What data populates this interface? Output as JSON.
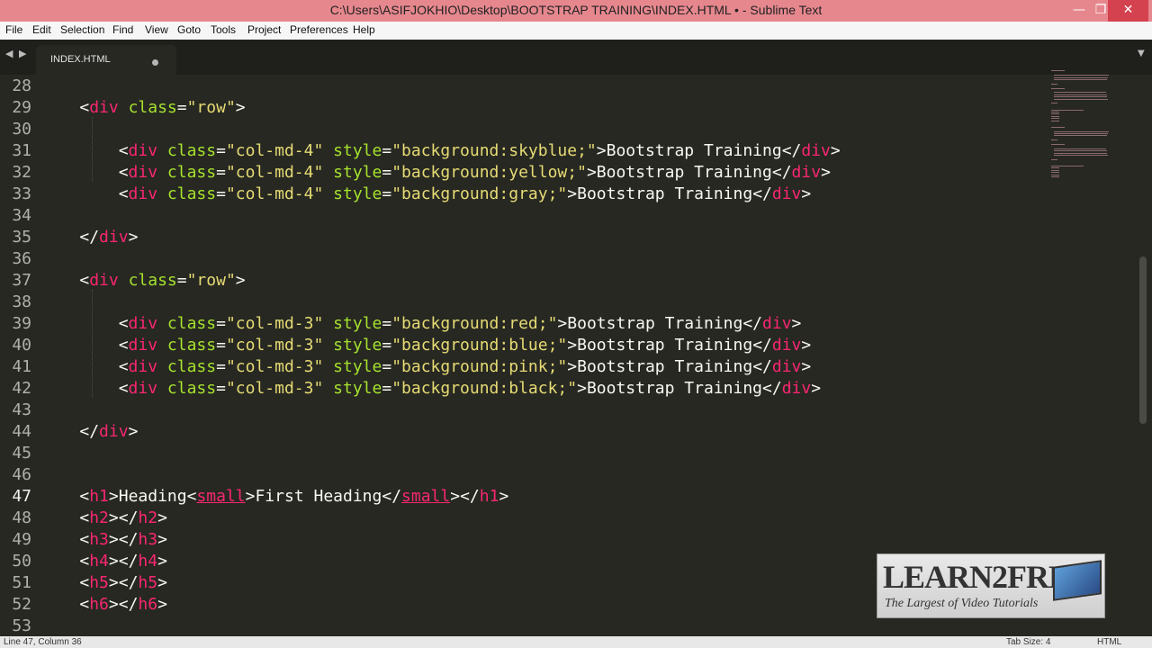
{
  "window": {
    "title": "C:\\Users\\ASIFJOKHIO\\Desktop\\BOOTSTRAP TRAINING\\INDEX.HTML • - Sublime Text",
    "minimize": "—",
    "maximize": "❐",
    "close": "✕"
  },
  "menu": {
    "file": "File",
    "edit": "Edit",
    "selection": "Selection",
    "find": "Find",
    "view": "View",
    "goto": "Goto",
    "tools": "Tools",
    "project": "Project",
    "preferences": "Preferences",
    "help": "Help"
  },
  "tabbar": {
    "prev": "◀",
    "next": "▶",
    "dropdown": "▼"
  },
  "tab": {
    "label": "INDEX.HTML",
    "modified": true
  },
  "editor": {
    "current_line": "47",
    "lines": [
      {
        "n": "28",
        "t": ""
      },
      {
        "n": "29",
        "t": "    <div class=\"row\">"
      },
      {
        "n": "30",
        "t": ""
      },
      {
        "n": "31",
        "t": "        <div class=\"col-md-4\" style=\"background:skyblue;\">Bootstrap Training</div>"
      },
      {
        "n": "32",
        "t": "        <div class=\"col-md-4\" style=\"background:yellow;\">Bootstrap Training</div>"
      },
      {
        "n": "33",
        "t": "        <div class=\"col-md-4\" style=\"background:gray;\">Bootstrap Training</div>"
      },
      {
        "n": "34",
        "t": ""
      },
      {
        "n": "35",
        "t": "    </div>"
      },
      {
        "n": "36",
        "t": ""
      },
      {
        "n": "37",
        "t": "    <div class=\"row\">"
      },
      {
        "n": "38",
        "t": ""
      },
      {
        "n": "39",
        "t": "        <div class=\"col-md-3\" style=\"background:red;\">Bootstrap Training</div>"
      },
      {
        "n": "40",
        "t": "        <div class=\"col-md-3\" style=\"background:blue;\">Bootstrap Training</div>"
      },
      {
        "n": "41",
        "t": "        <div class=\"col-md-3\" style=\"background:pink;\">Bootstrap Training</div>"
      },
      {
        "n": "42",
        "t": "        <div class=\"col-md-3\" style=\"background:black;\">Bootstrap Training</div>"
      },
      {
        "n": "43",
        "t": ""
      },
      {
        "n": "44",
        "t": "    </div>"
      },
      {
        "n": "45",
        "t": ""
      },
      {
        "n": "46",
        "t": ""
      },
      {
        "n": "47",
        "t": "    <h1>Heading<small>First Heading</small></h1>"
      },
      {
        "n": "48",
        "t": "    <h2></h2>"
      },
      {
        "n": "49",
        "t": "    <h3></h3>"
      },
      {
        "n": "50",
        "t": "    <h4></h4>"
      },
      {
        "n": "51",
        "t": "    <h5></h5>"
      },
      {
        "n": "52",
        "t": "    <h6></h6>"
      },
      {
        "n": "53",
        "t": ""
      }
    ]
  },
  "logo": {
    "main": "LEARN2FREE",
    "tagline": "The Largest of Video Tutorials"
  },
  "status": {
    "position": "Line 47, Column 36",
    "tab_size": "Tab Size: 4",
    "syntax": "HTML"
  },
  "colors": {
    "background": "#272822",
    "tag": "#f92672",
    "attribute": "#a6e22e",
    "string": "#e6db74",
    "text": "#f8f8f2",
    "titlebar": "#e6878e"
  }
}
